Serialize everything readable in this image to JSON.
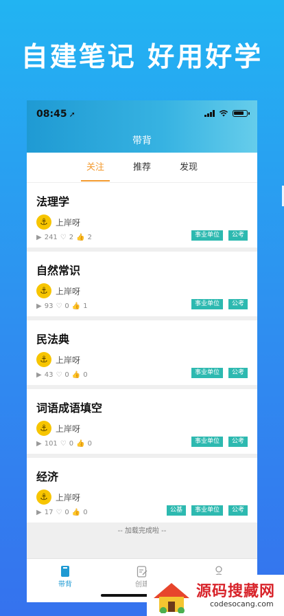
{
  "headline": "自建笔记  好用好学",
  "status_bar": {
    "time": "08:45",
    "location_glyph": "➚"
  },
  "header": {
    "title": "带背"
  },
  "tabs": [
    {
      "label": "关注",
      "active": true
    },
    {
      "label": "推荐",
      "active": false
    },
    {
      "label": "发现",
      "active": false
    }
  ],
  "notes": [
    {
      "title": "法理学",
      "author": "上岸呀",
      "plays": "241",
      "likes": "2",
      "thumbs": "2",
      "tags": [
        "事业单位",
        "公考"
      ]
    },
    {
      "title": "自然常识",
      "author": "上岸呀",
      "plays": "93",
      "likes": "0",
      "thumbs": "1",
      "tags": [
        "事业单位",
        "公考"
      ]
    },
    {
      "title": "民法典",
      "author": "上岸呀",
      "plays": "43",
      "likes": "0",
      "thumbs": "0",
      "tags": [
        "事业单位",
        "公考"
      ]
    },
    {
      "title": "词语成语填空",
      "author": "上岸呀",
      "plays": "101",
      "likes": "0",
      "thumbs": "0",
      "tags": [
        "事业单位",
        "公考"
      ]
    },
    {
      "title": "经济",
      "author": "上岸呀",
      "plays": "17",
      "likes": "0",
      "thumbs": "0",
      "tags": [
        "公基",
        "事业单位",
        "公考"
      ]
    }
  ],
  "footer_note": "-- 加载完成啦 --",
  "tabbar": [
    {
      "label": "带背",
      "icon": "book-icon",
      "active": true
    },
    {
      "label": "创建",
      "icon": "edit-icon",
      "active": false
    },
    {
      "label": "",
      "icon": "user-icon",
      "active": false
    }
  ],
  "watermark": {
    "text": "源码搜藏网",
    "url": "codesocang.com"
  },
  "colors": {
    "accent": "#f39a2e",
    "tag": "#2db9b0",
    "header": "#1f9ad3",
    "avatar": "#f7c500"
  }
}
